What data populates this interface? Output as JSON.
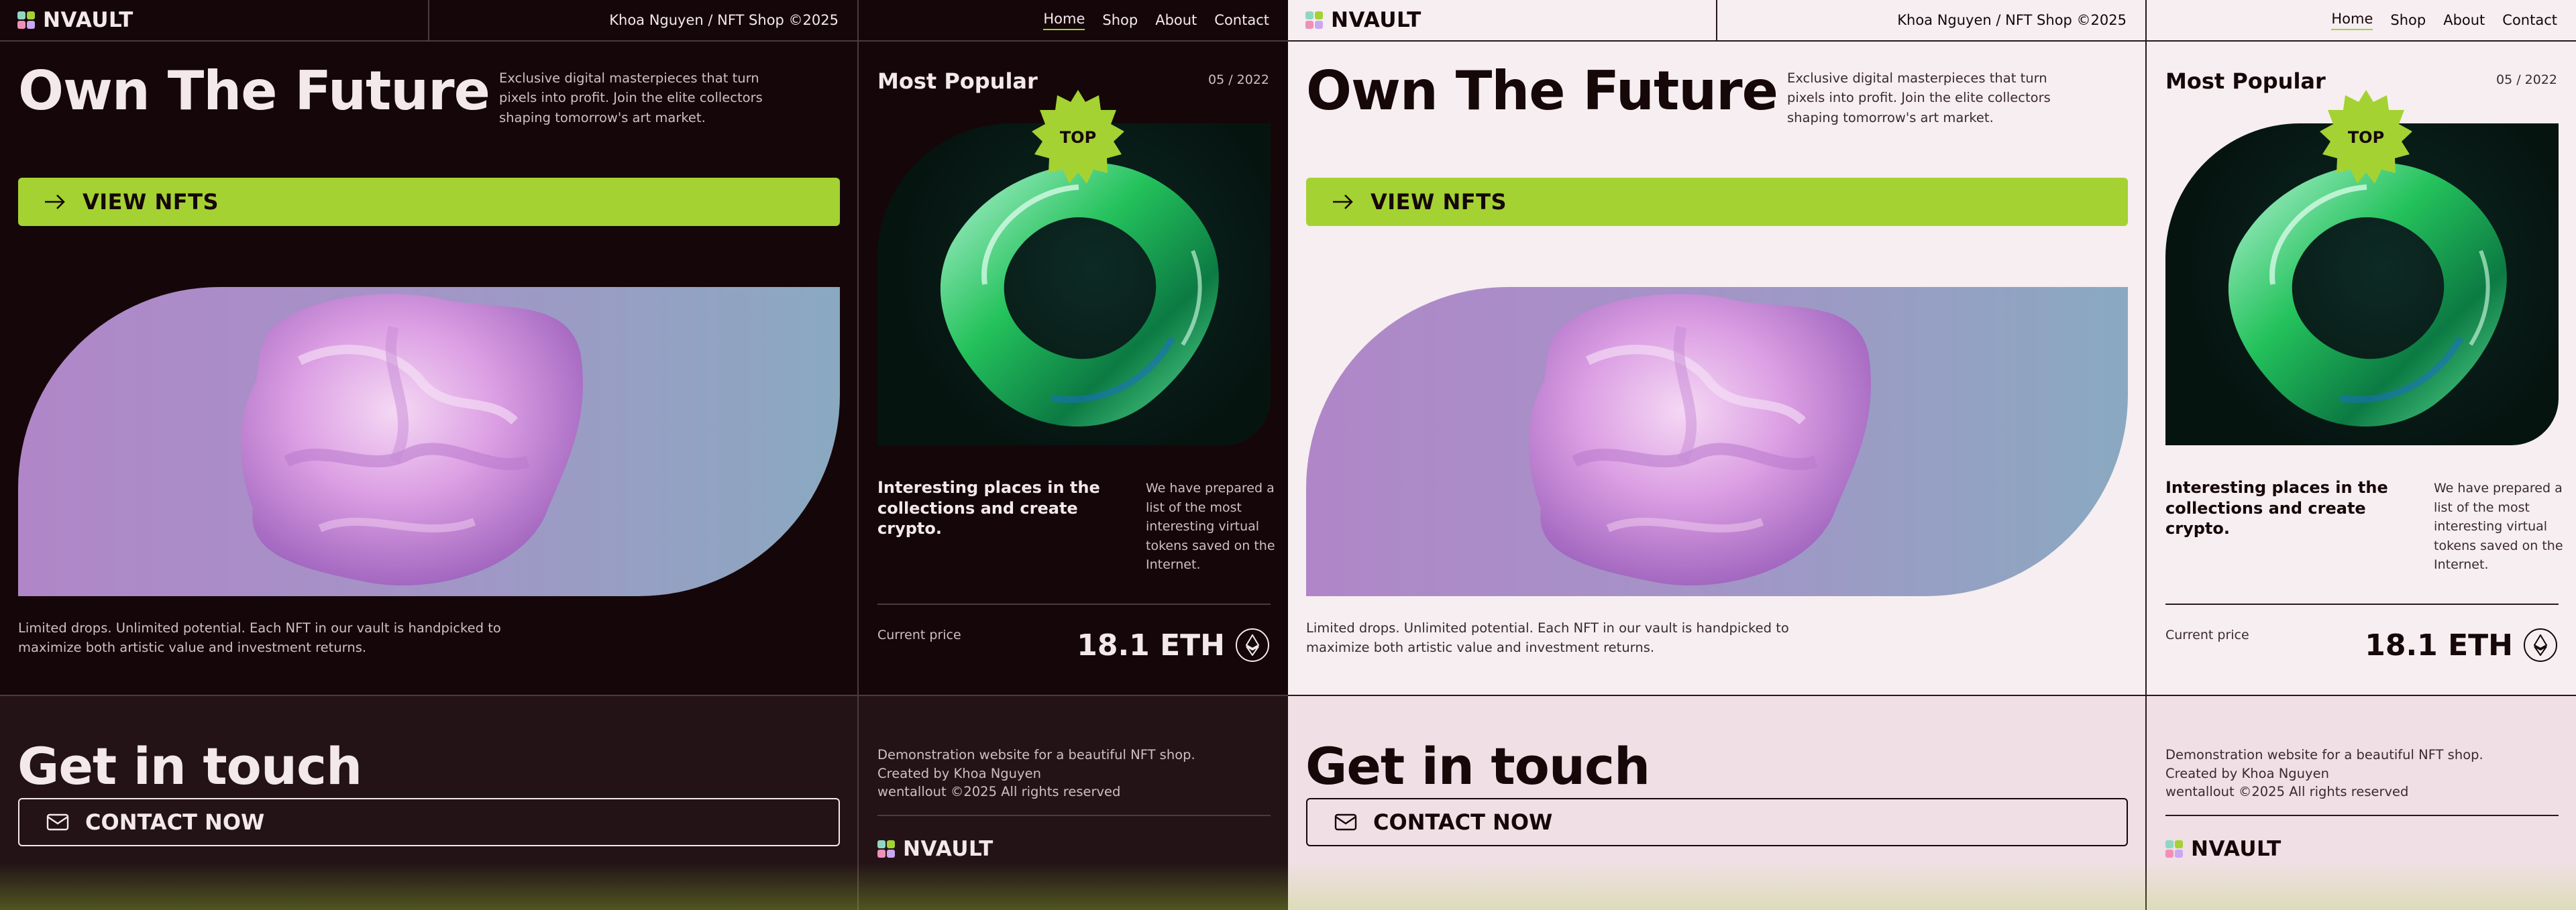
{
  "brand": {
    "name": "NVAULT"
  },
  "topbar": {
    "credit": "Khoa Nguyen / NFT Shop ©2025"
  },
  "nav": {
    "items": [
      "Home",
      "Shop",
      "About",
      "Contact"
    ],
    "active": "Home"
  },
  "hero": {
    "title": "Own The Future",
    "desc": "Exclusive digital masterpieces that turn pixels into profit. Join the elite collectors shaping tomorrow's art market.",
    "cta": "VIEW NFTS",
    "caption": "Limited drops. Unlimited potential. Each NFT in our vault is handpicked to maximize both artistic value and investment returns."
  },
  "popular": {
    "title": "Most Popular",
    "date": "05 / 2022",
    "badge": "TOP",
    "heading": "Interesting places in the collections and create crypto.",
    "body": "We have prepared a list of the most interesting virtual tokens saved on the Internet.",
    "price_label": "Current price",
    "price": "18.1 ETH"
  },
  "footer": {
    "title": "Get in touch",
    "contact": "CONTACT NOW",
    "lines": [
      "Demonstration website for a beautiful NFT shop.",
      "Created by Khoa Nguyen",
      "wentallout ©2025 All rights reserved"
    ]
  },
  "colors": {
    "accent": "#a4d233",
    "dark_bg": "#150709",
    "light_bg": "#f6eef0"
  },
  "icons": [
    "arrow-right-icon",
    "mail-icon",
    "ethereum-icon",
    "logo-icon"
  ]
}
